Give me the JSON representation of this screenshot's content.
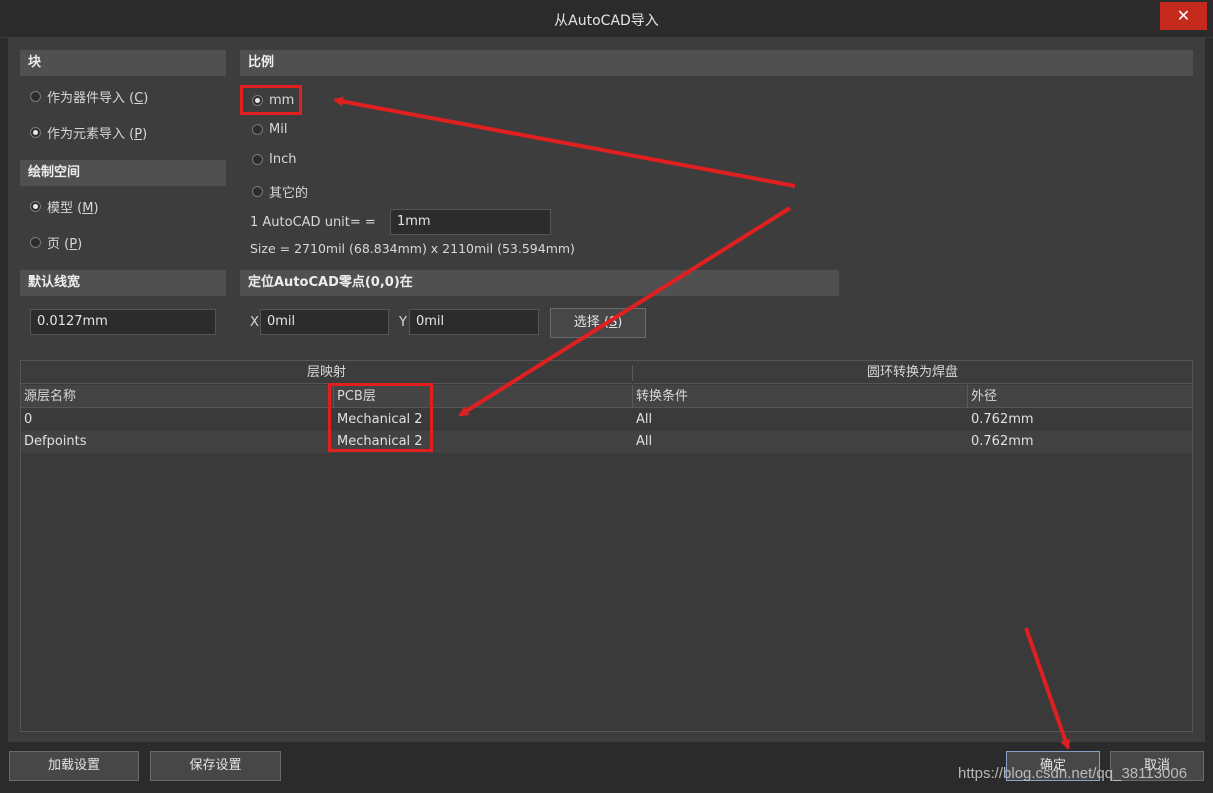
{
  "window": {
    "title": "从AutoCAD导入",
    "close_glyph": "✕"
  },
  "block": {
    "header": "块",
    "options": [
      {
        "label": "作为器件导入 (",
        "key": "C",
        "suffix": ")",
        "checked": false
      },
      {
        "label": "作为元素导入 (",
        "key": "P",
        "suffix": ")",
        "checked": true
      }
    ]
  },
  "drawing_space": {
    "header": "绘制空间",
    "options": [
      {
        "label": "模型 (",
        "key": "M",
        "suffix": ")",
        "checked": true
      },
      {
        "label": "页 (",
        "key": "P",
        "suffix": ")",
        "checked": false
      }
    ]
  },
  "default_width": {
    "header": "默认线宽",
    "value": "0.0127mm"
  },
  "scale": {
    "header": "比例",
    "options": [
      {
        "label": "mm",
        "checked": true
      },
      {
        "label": "Mil",
        "checked": false
      },
      {
        "label": "Inch",
        "checked": false
      },
      {
        "label": "其它的",
        "checked": false
      }
    ],
    "unit_label": "1 AutoCAD unit= =",
    "unit_value": "1mm",
    "size_text": "Size = 2710mil (68.834mm) x 2110mil (53.594mm)"
  },
  "origin": {
    "header": "定位AutoCAD零点(0,0)在",
    "x_label": "X",
    "x_value": "0mil",
    "y_label": "Y",
    "y_value": "0mil",
    "select_label": "选择 (",
    "select_key": "S",
    "select_suffix": ")"
  },
  "grid": {
    "group_headers": [
      "层映射",
      "圆环转换为焊盘"
    ],
    "columns": [
      "源层名称",
      "PCB层",
      "转换条件",
      "外径"
    ],
    "rows": [
      [
        "0",
        "Mechanical 2",
        "All",
        "0.762mm"
      ],
      [
        "Defpoints",
        "Mechanical 2",
        "All",
        "0.762mm"
      ]
    ]
  },
  "footer": {
    "load_label": "加载设置",
    "save_label": "保存设置",
    "ok_label": "确定",
    "cancel_label": "取消"
  },
  "watermark": "https://blog.csdn.net/qq_38113006",
  "colors": {
    "annotation": "#e02020",
    "close": "#c42b1c"
  }
}
